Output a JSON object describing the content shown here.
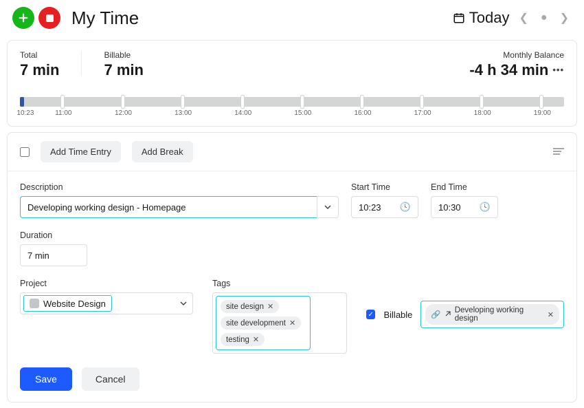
{
  "header": {
    "title": "My Time",
    "today_label": "Today"
  },
  "summary": {
    "total_label": "Total",
    "total_value": "7 min",
    "billable_label": "Billable",
    "billable_value": "7 min",
    "balance_label": "Monthly Balance",
    "balance_value": "-4 h 34 min"
  },
  "timeline": {
    "start_label": "10:23",
    "ticks": [
      "11:00",
      "12:00",
      "13:00",
      "14:00",
      "15:00",
      "16:00",
      "17:00",
      "18:00",
      "19:00"
    ]
  },
  "toolbar": {
    "add_entry_label": "Add Time Entry",
    "add_break_label": "Add Break"
  },
  "form": {
    "description_label": "Description",
    "description_value": "Developing working design - Homepage",
    "start_label": "Start Time",
    "start_value": "10:23",
    "end_label": "End Time",
    "end_value": "10:30",
    "duration_label": "Duration",
    "duration_value": "7 min",
    "project_label": "Project",
    "project_value": "Website Design",
    "tags_label": "Tags",
    "tags": [
      "site design",
      "site development",
      "testing"
    ],
    "billable_label": "Billable",
    "linked_item": "Developing working design"
  },
  "actions": {
    "save_label": "Save",
    "cancel_label": "Cancel"
  }
}
